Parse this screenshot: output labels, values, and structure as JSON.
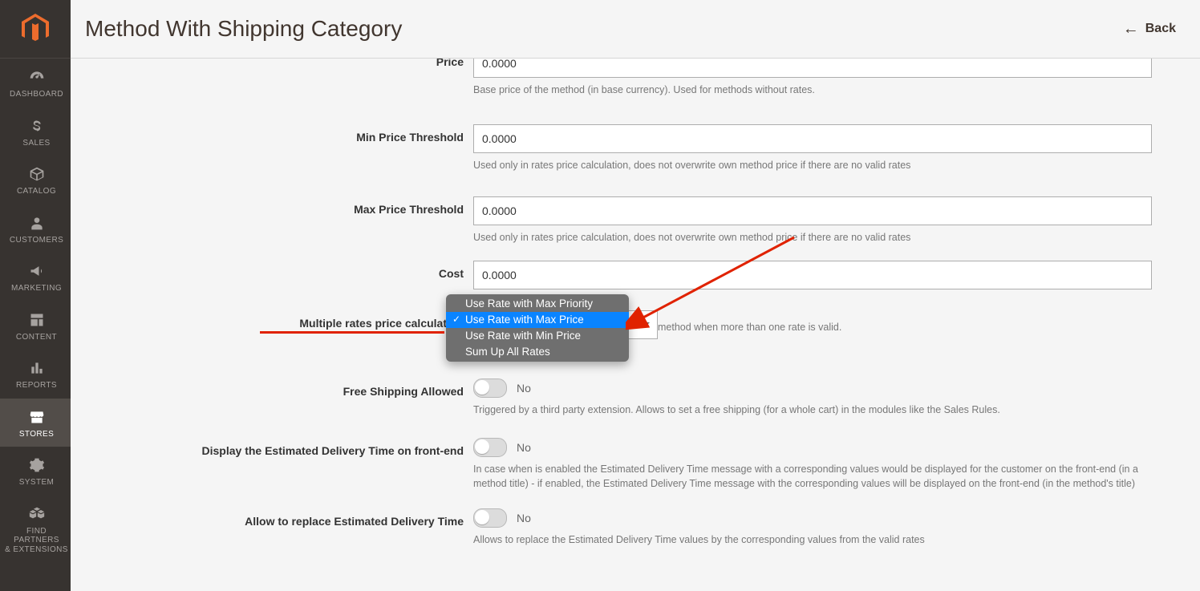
{
  "header": {
    "title": "Method With Shipping Category",
    "back_label": "Back"
  },
  "sidebar": {
    "items": [
      {
        "label": "DASHBOARD",
        "icon": "gauge"
      },
      {
        "label": "SALES",
        "icon": "dollar"
      },
      {
        "label": "CATALOG",
        "icon": "box"
      },
      {
        "label": "CUSTOMERS",
        "icon": "person"
      },
      {
        "label": "MARKETING",
        "icon": "megaphone"
      },
      {
        "label": "CONTENT",
        "icon": "layout"
      },
      {
        "label": "REPORTS",
        "icon": "bars"
      },
      {
        "label": "STORES",
        "icon": "storefront",
        "active": true
      },
      {
        "label": "SYSTEM",
        "icon": "gear"
      },
      {
        "label": "FIND PARTNERS\n& EXTENSIONS",
        "icon": "cubes"
      }
    ]
  },
  "form": {
    "price": {
      "label": "Price",
      "value": "0.0000",
      "help": "Base price of the method (in base currency). Used for methods without rates."
    },
    "min_threshold": {
      "label": "Min Price Threshold",
      "value": "0.0000",
      "help": "Used only in rates price calculation, does not overwrite own method price if there are no valid rates"
    },
    "max_threshold": {
      "label": "Max Price Threshold",
      "value": "0.0000",
      "help": "Used only in rates price calculation, does not overwrite own method price if there are no valid rates"
    },
    "cost": {
      "label": "Cost",
      "value": "0.0000"
    },
    "multi_rates": {
      "label": "Multiple rates price calculation",
      "required_mark": "*",
      "help_tail": "method when more than one rate is valid.",
      "options": [
        "Use Rate with Max Priority",
        "Use Rate with Max Price",
        "Use Rate with Min Price",
        "Sum Up All Rates"
      ],
      "selected_index": 1
    },
    "free_shipping": {
      "label": "Free Shipping Allowed",
      "state_label": "No",
      "help": "Triggered by a third party extension. Allows to set a free shipping (for a whole cart) in the modules like the Sales Rules."
    },
    "display_edt": {
      "label": "Display the Estimated Delivery Time on front-end",
      "state_label": "No",
      "help": "In case when is enabled the Estimated Delivery Time message with a corresponding values would be displayed for the customer on the front-end (in a method title) - if enabled, the Estimated Delivery Time message with the corresponding values will be displayed on the front-end (in the method's title)"
    },
    "replace_edt": {
      "label": "Allow to replace Estimated Delivery Time",
      "state_label": "No",
      "help": "Allows to replace the Estimated Delivery Time values by the corresponding values from the valid rates"
    }
  }
}
